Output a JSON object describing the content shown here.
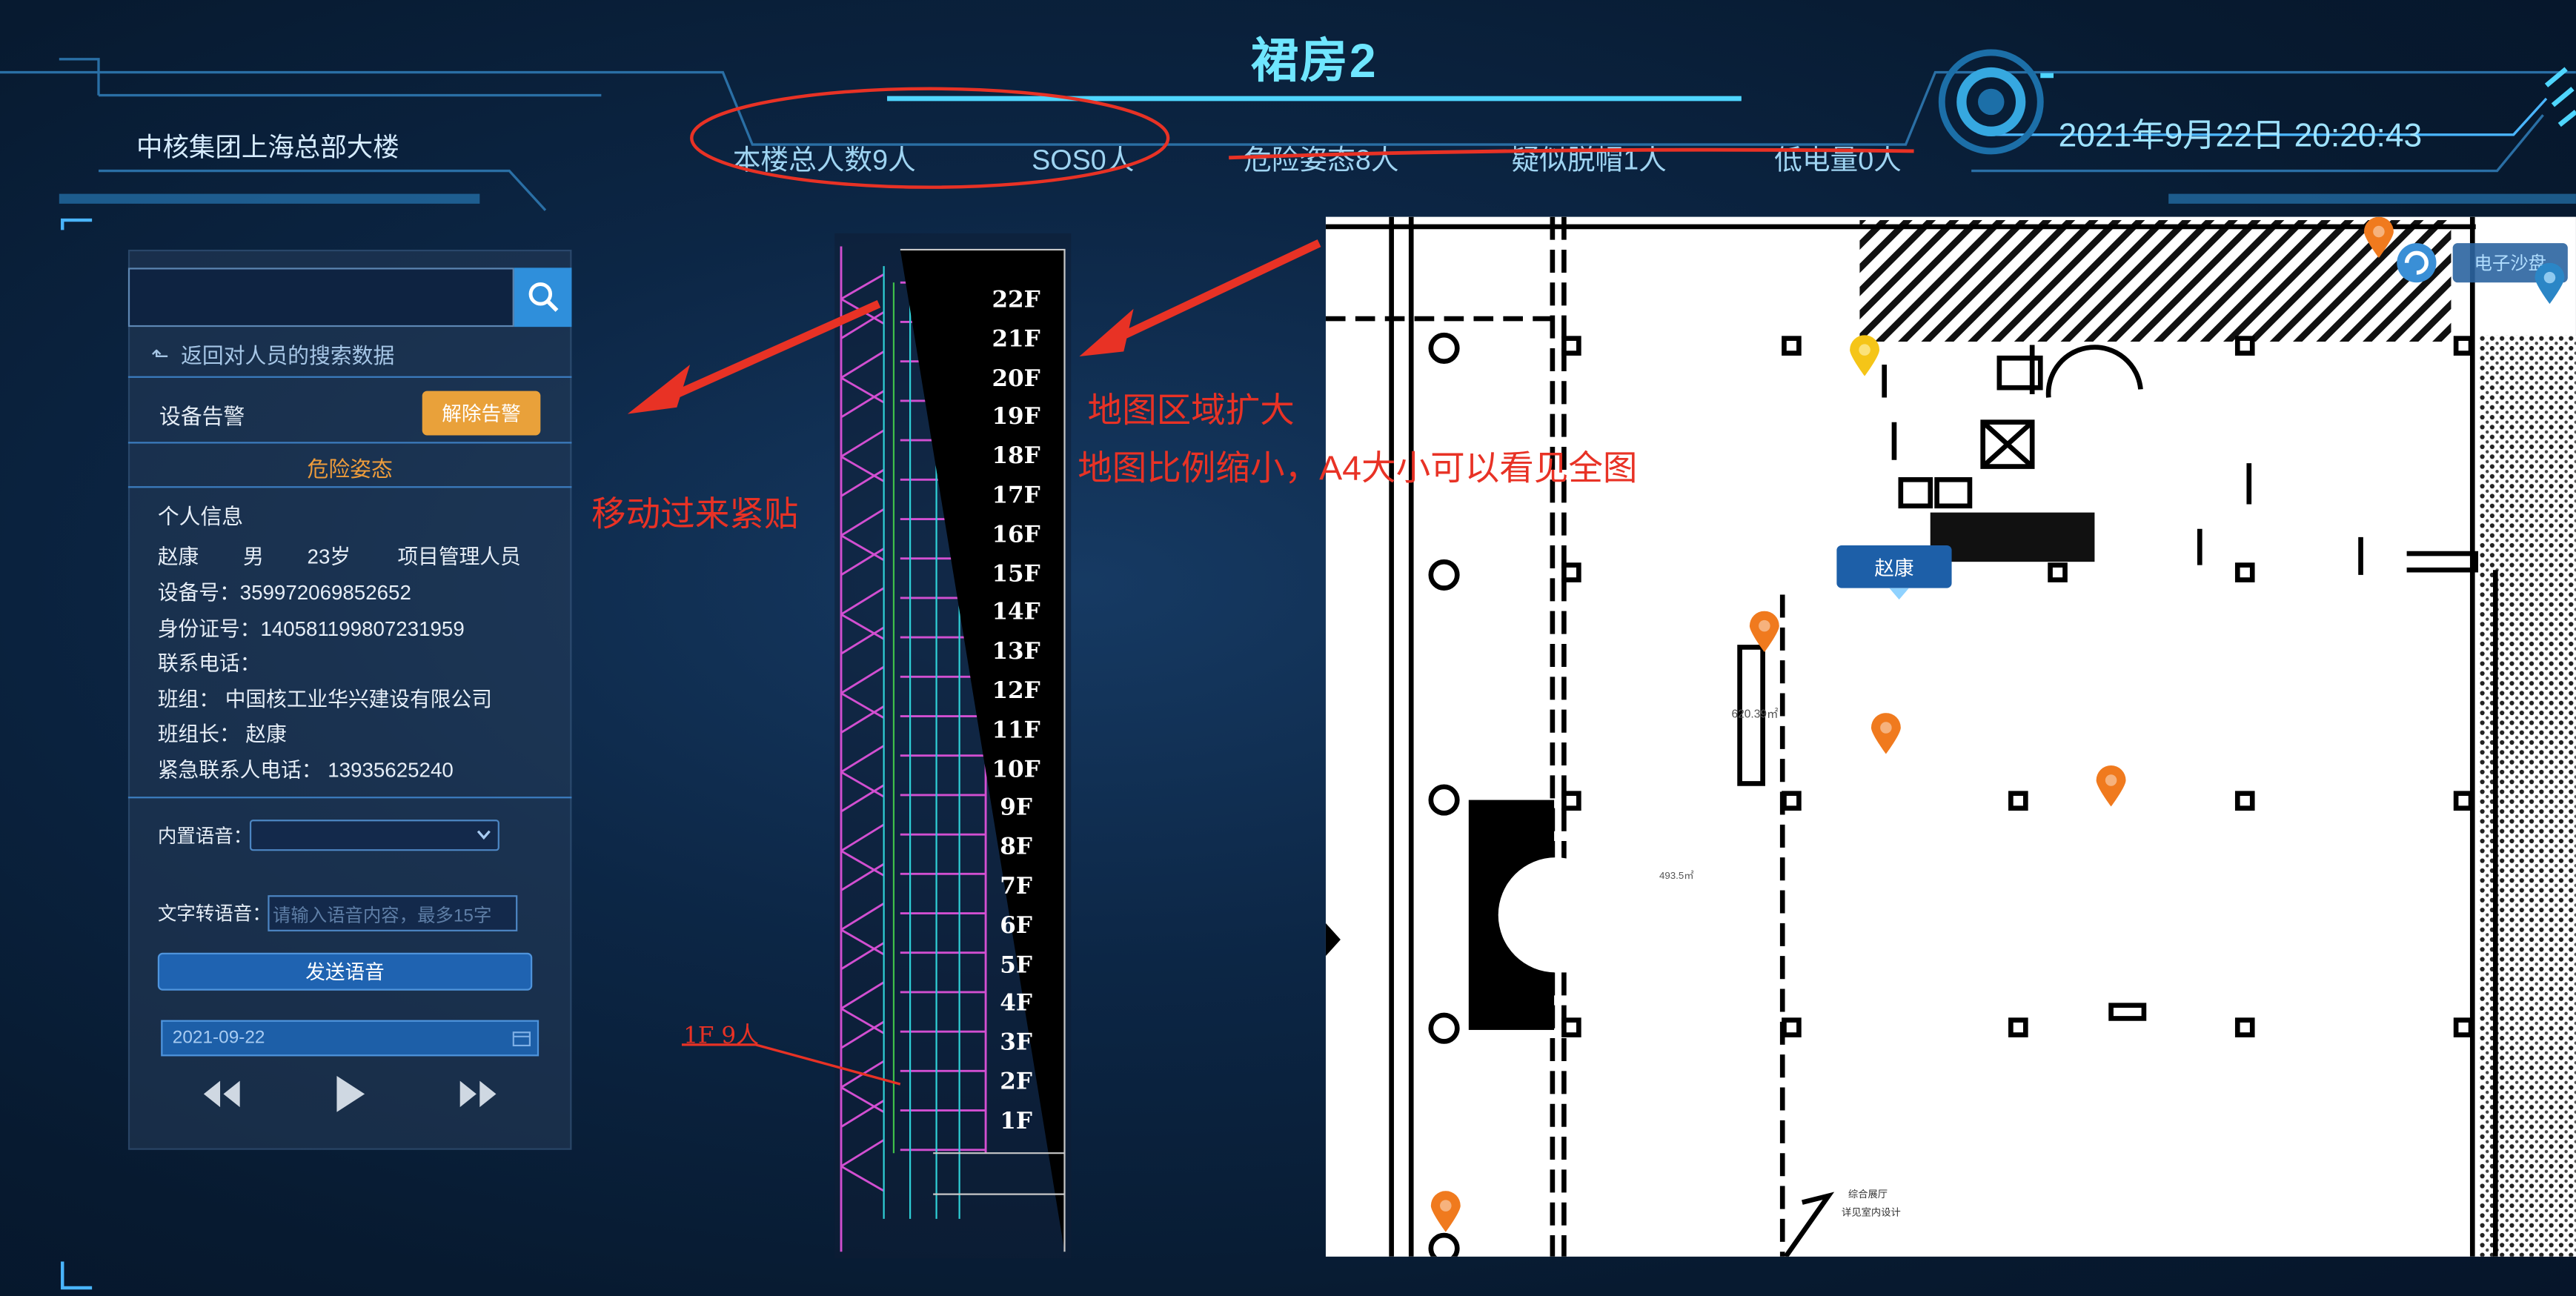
{
  "header": {
    "title": "裙房2",
    "building_name": "中核集团上海总部大楼",
    "datetime": "2021年9月22日  20:20:43",
    "stats": [
      "本楼总人数9人",
      "SOS0人",
      "危险姿态8人",
      "疑似脱帽1人",
      "低电量0人"
    ]
  },
  "sidebar": {
    "back_label": "返回对人员的搜索数据",
    "alarm_label": "设备告警",
    "clear_alarm_button": "解除告警",
    "danger_title": "危险姿态",
    "personal_info_title": "个人信息",
    "name": "赵康",
    "gender": "男",
    "age": "23岁",
    "role": "项目管理人员",
    "device_label": "设备号：",
    "device_no": "359972069852652",
    "id_label": "身份证号：",
    "id_no": "140581199807231959",
    "phone_label": "联系电话：",
    "team_label": "班组：",
    "team": "中国核工业华兴建设有限公司",
    "leader_label": "班组长：",
    "leader": "赵康",
    "emergency_label": "紧急联系人电话：",
    "emergency_phone": "13935625240",
    "voice_label": "内置语音：",
    "tts_label": "文字转语音：",
    "tts_placeholder": "请输入语音内容，最多15字",
    "send_button": "发送语音",
    "date": "2021-09-22"
  },
  "floors": [
    "22F",
    "21F",
    "20F",
    "19F",
    "18F",
    "17F",
    "16F",
    "15F",
    "14F",
    "13F",
    "12F",
    "11F",
    "10F",
    "9F",
    "8F",
    "7F",
    "6F",
    "5F",
    "4F",
    "3F",
    "2F",
    "1F"
  ],
  "map": {
    "person_tag": "赵康",
    "sandbox_button": "电子沙盘",
    "area_label_1": "620.39㎡",
    "area_label_2": "493.5㎡",
    "room_label_1": "综合展厅",
    "room_label_2": "详见室内设计"
  },
  "annotations": {
    "note_move": "移动过来紧贴",
    "note_expand": "地图区域扩大",
    "note_scale": "地图比例缩小，A4大小可以看见全图",
    "note_floor": "1F 9人"
  },
  "colors": {
    "accent": "#6fe6ff",
    "annotation": "#e83225",
    "alarm_button": "#e9a13a",
    "send_button": "#1f63b1",
    "marker": "#f07a1e"
  }
}
